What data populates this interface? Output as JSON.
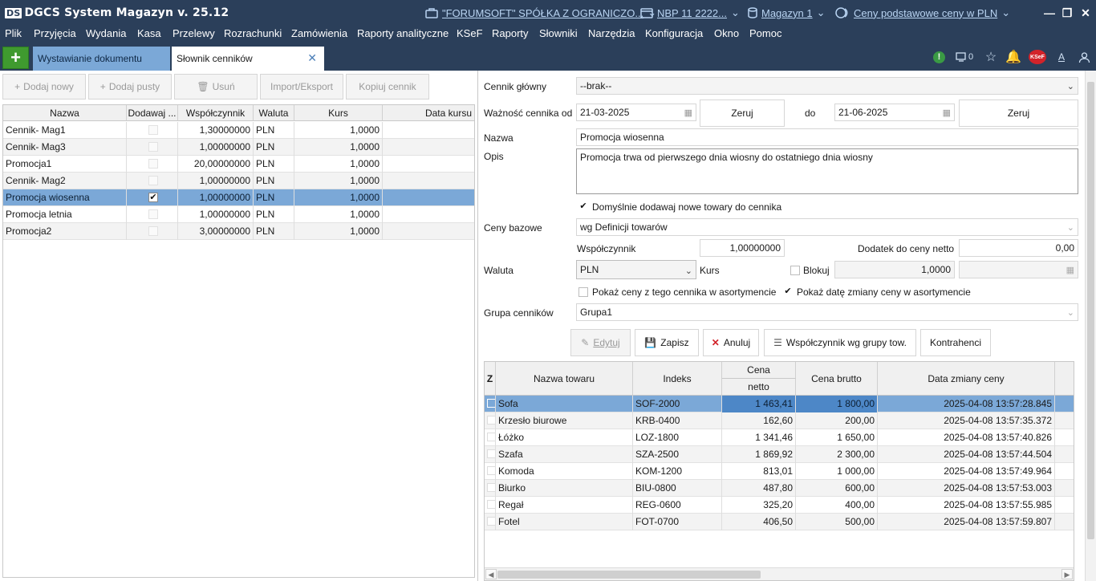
{
  "app": {
    "logo": "DS",
    "title": "DGCS System Magazyn v. 25.12",
    "company": "\"FORUMSOFT\" SPÓŁKA Z OGRANICZO...",
    "nbp": "NBP 11 2222...",
    "warehouse": "Magazyn 1",
    "prices": "Ceny podstawowe ceny w PLN"
  },
  "menu": [
    "Plik",
    "Przyjęcia",
    "Wydania",
    "Kasa",
    "Przelewy",
    "Rozrachunki",
    "Zamówienia",
    "Raporty analityczne",
    "KSeF",
    "Raporty",
    "Słowniki",
    "Narzędzia",
    "Konfiguracja",
    "Okno",
    "Pomoc"
  ],
  "tabs": {
    "new": "+",
    "inactive": "Wystawianie dokumentu",
    "active": "Słownik cenników",
    "close": "✕"
  },
  "tray": {
    "monitor_count": "0",
    "ksef": "KSeF",
    "font": "A"
  },
  "left_toolbar": {
    "add_new": "Dodaj nowy",
    "add_empty": "Dodaj pusty",
    "delete": "Usuń",
    "import_export": "Import/Eksport",
    "copy": "Kopiuj cennik"
  },
  "left_grid": {
    "headers": [
      "Nazwa",
      "Dodawaj ...",
      "Współczynnik",
      "Waluta",
      "Kurs",
      "Data kursu"
    ],
    "rows": [
      {
        "name": "Cennik- Mag1",
        "factor": "1,30000000",
        "currency": "PLN",
        "rate": "1,0000",
        "checked": false
      },
      {
        "name": "Cennik- Mag3",
        "factor": "1,00000000",
        "currency": "PLN",
        "rate": "1,0000",
        "checked": false
      },
      {
        "name": "Promocja1",
        "factor": "20,00000000",
        "currency": "PLN",
        "rate": "1,0000",
        "checked": false
      },
      {
        "name": "Cennik- Mag2",
        "factor": "1,00000000",
        "currency": "PLN",
        "rate": "1,0000",
        "checked": false
      },
      {
        "name": "Promocja wiosenna",
        "factor": "1,00000000",
        "currency": "PLN",
        "rate": "1,0000",
        "checked": true
      },
      {
        "name": "Promocja letnia",
        "factor": "1,00000000",
        "currency": "PLN",
        "rate": "1,0000",
        "checked": false
      },
      {
        "name": "Promocja2",
        "factor": "3,00000000",
        "currency": "PLN",
        "rate": "1,0000",
        "checked": false
      }
    ]
  },
  "form": {
    "main_pricelist_label": "Cennik główny",
    "main_pricelist_value": "--brak--",
    "validity_label": "Ważność cennika od",
    "valid_from": "21-03-2025",
    "reset": "Zeruj",
    "to_label": "do",
    "valid_to": "21-06-2025",
    "name_label": "Nazwa",
    "name_value": "Promocja wiosenna",
    "desc_label": "Opis",
    "desc_value": "Promocja trwa od pierwszego dnia wiosny do ostatniego dnia wiosny",
    "default_add_label": "Domyślnie dodawaj nowe towary do cennika",
    "base_prices_label": "Ceny bazowe",
    "base_prices_value": "wg Definicji towarów",
    "factor_label": "Współczynnik",
    "factor_value": "1,00000000",
    "addon_label": "Dodatek do ceny netto",
    "addon_value": "0,00",
    "currency_label": "Waluta",
    "currency_value": "PLN",
    "rate_label": "Kurs",
    "lock_label": "Blokuj",
    "rate_value": "1,0000",
    "show_prices_label": "Pokaż ceny z tego cennika w asortymencie",
    "show_date_label": "Pokaż datę zmiany ceny w asortymencie",
    "group_label": "Grupa cenników",
    "group_value": "Grupa1"
  },
  "actions": {
    "edit": "Edytuj",
    "save": "Zapisz",
    "cancel": "Anuluj",
    "factor_group": "Współczynnik wg grupy tow.",
    "contractors": "Kontrahenci"
  },
  "right_grid": {
    "headers": {
      "z": "Z",
      "name": "Nazwa towaru",
      "index": "Indeks",
      "net_top": "Cena",
      "net_bottom": "netto",
      "gross": "Cena brutto",
      "date": "Data zmiany ceny"
    },
    "rows": [
      {
        "name": "Sofa",
        "index": "SOF-2000",
        "net": "1 463,41",
        "gross": "1 800,00",
        "date": "2025-04-08 13:57:28.845"
      },
      {
        "name": "Krzesło biurowe",
        "index": "KRB-0400",
        "net": "162,60",
        "gross": "200,00",
        "date": "2025-04-08 13:57:35.372"
      },
      {
        "name": "Łóżko",
        "index": "LOZ-1800",
        "net": "1 341,46",
        "gross": "1 650,00",
        "date": "2025-04-08 13:57:40.826"
      },
      {
        "name": "Szafa",
        "index": "SZA-2500",
        "net": "1 869,92",
        "gross": "2 300,00",
        "date": "2025-04-08 13:57:44.504"
      },
      {
        "name": "Komoda",
        "index": "KOM-1200",
        "net": "813,01",
        "gross": "1 000,00",
        "date": "2025-04-08 13:57:49.964"
      },
      {
        "name": "Biurko",
        "index": "BIU-0800",
        "net": "487,80",
        "gross": "600,00",
        "date": "2025-04-08 13:57:53.003"
      },
      {
        "name": "Regał",
        "index": "REG-0600",
        "net": "325,20",
        "gross": "400,00",
        "date": "2025-04-08 13:57:55.985"
      },
      {
        "name": "Fotel",
        "index": "FOT-0700",
        "net": "406,50",
        "gross": "500,00",
        "date": "2025-04-08 13:57:59.807"
      }
    ]
  },
  "colors": {
    "titlebar": "#2b3f5a",
    "selection": "#7ba8d7",
    "accent_green": "#3f9a2f"
  }
}
